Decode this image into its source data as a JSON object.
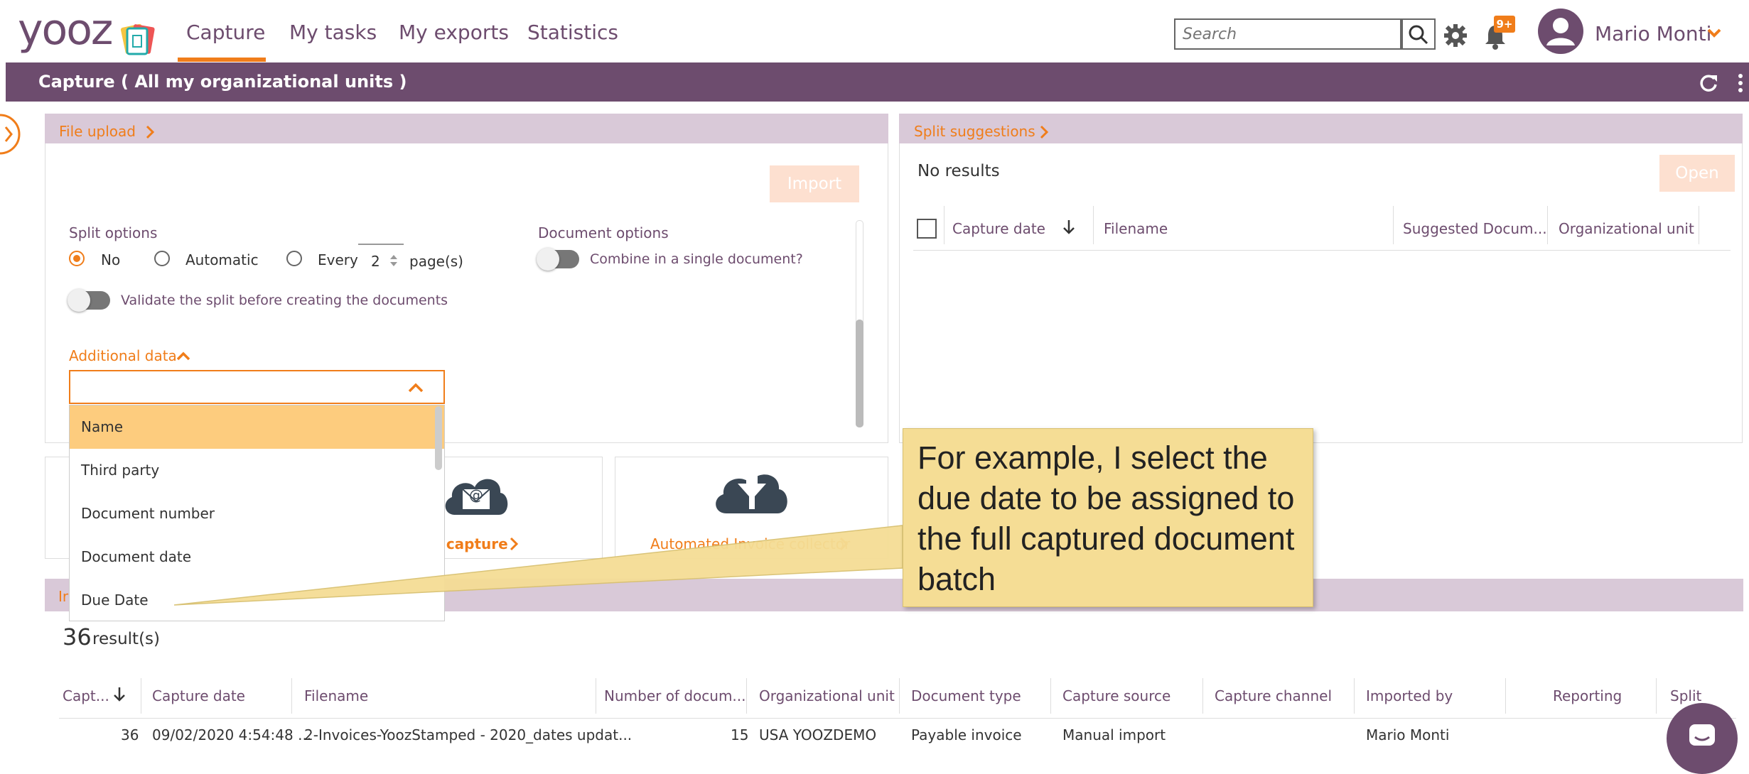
{
  "header": {
    "logo": "yooz",
    "tabs": [
      "Capture",
      "My tasks",
      "My exports",
      "Statistics"
    ],
    "search_placeholder": "Search",
    "notifications_badge": "9+",
    "user_name": "Mario Monti"
  },
  "subheader": {
    "title": "Capture ( All my organizational units )"
  },
  "file_upload": {
    "title": "File upload",
    "import_button": "Import",
    "split_options_label": "Split options",
    "split_no": "No",
    "split_automatic": "Automatic",
    "split_every": "Every",
    "split_every_value": "2",
    "split_pages_suffix": "page(s)",
    "validate_split_label": "Validate the split before creating the documents",
    "document_options_label": "Document options",
    "combine_label": "Combine in a single document?",
    "additional_data_label": "Additional data",
    "dropdown_items": [
      "Name",
      "Third party",
      "Document number",
      "Document date",
      "Due Date"
    ]
  },
  "capture_tiles": {
    "email_capture_label": "l capture",
    "aic_label": "Automated Invoice collector"
  },
  "split_suggestions": {
    "title": "Split suggestions",
    "no_results": "No results",
    "open_button": "Open",
    "columns": [
      "Capture date",
      "Filename",
      "Suggested Docum...",
      "Organizational unit"
    ]
  },
  "imports": {
    "section_title_fragment": "Ir",
    "result_count": "36",
    "result_suffix": "result(s)",
    "columns": [
      "Capt...",
      "Capture date",
      "Filename",
      "Number of docum...",
      "Organizational unit",
      "Document type",
      "Capture source",
      "Capture channel",
      "Imported by",
      "Reporting",
      "Split"
    ],
    "rows": [
      [
        "36",
        "09/02/2020 4:54:48 ...",
        "2-Invoices-YoozStamped - 2020_dates updat...",
        "15",
        "USA YOOZDEMO",
        "Payable invoice",
        "Manual import",
        "",
        "Mario Monti",
        "",
        ""
      ]
    ]
  },
  "callout": {
    "text": "For example, I select the due date to be assigned to the full captured document batch"
  },
  "colors": {
    "brand_purple": "#6d4c6e",
    "accent_orange": "#f07d1a",
    "panel_header": "#d9c9d8",
    "callout_bg": "#f5dd95"
  }
}
